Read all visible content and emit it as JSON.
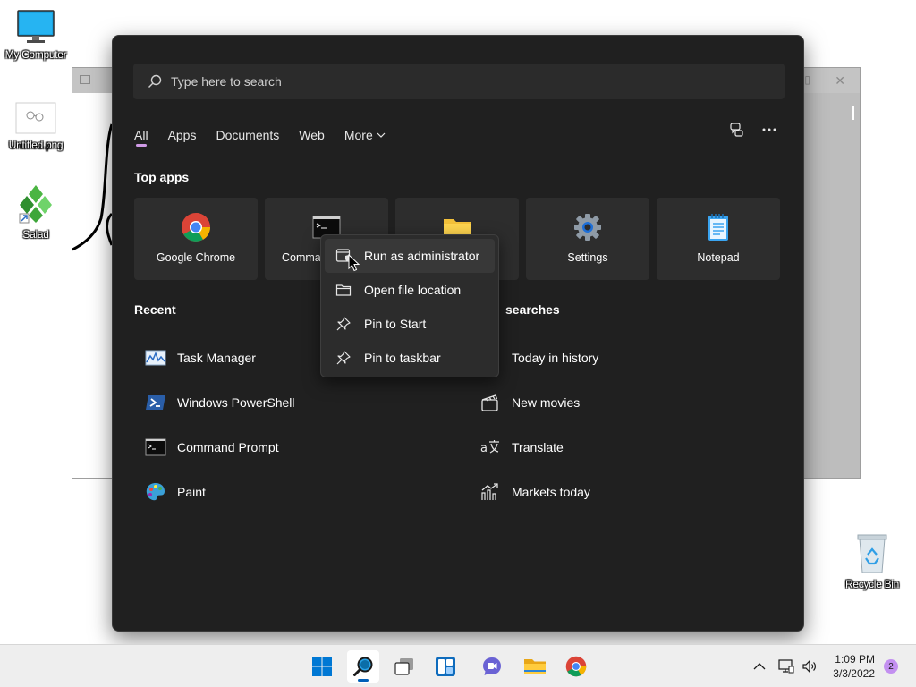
{
  "desktop": {
    "icons": [
      {
        "label": "My Computer"
      },
      {
        "label": "Untitled.png"
      },
      {
        "label": "Salad"
      },
      {
        "label": "Recycle Bin"
      }
    ]
  },
  "start": {
    "search_placeholder": "Type here to search",
    "tabs": [
      {
        "label": "All"
      },
      {
        "label": "Apps"
      },
      {
        "label": "Documents"
      },
      {
        "label": "Web"
      },
      {
        "label": "More"
      }
    ],
    "top_apps_title": "Top apps",
    "top_apps": [
      {
        "label": "Google Chrome"
      },
      {
        "label": "Comma"
      },
      {
        "label": ""
      },
      {
        "label": "Settings"
      },
      {
        "label": "Notepad"
      }
    ],
    "recent_title": "Recent",
    "recent": [
      {
        "label": "Task Manager"
      },
      {
        "label": "Windows PowerShell"
      },
      {
        "label": "Command Prompt"
      },
      {
        "label": "Paint"
      }
    ],
    "searches_title": "searches",
    "searches": [
      {
        "label": "Today in history"
      },
      {
        "label": "New movies"
      },
      {
        "label": "Translate"
      },
      {
        "label": "Markets today"
      }
    ]
  },
  "context_menu": {
    "items": [
      {
        "label": "Run as administrator"
      },
      {
        "label": "Open file location"
      },
      {
        "label": "Pin to Start"
      },
      {
        "label": "Pin to taskbar"
      }
    ]
  },
  "taskbar": {
    "time": "1:09 PM",
    "date": "3/3/2022",
    "notification_count": "2"
  }
}
